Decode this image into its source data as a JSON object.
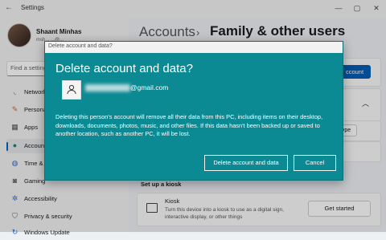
{
  "window": {
    "title": "Settings"
  },
  "profile": {
    "name": "Shaant Minhas",
    "email": "msh... ...@..."
  },
  "search": {
    "placeholder": "Find a setting"
  },
  "nav": [
    {
      "label": "Network & internet",
      "icon": "wifi-icon"
    },
    {
      "label": "Personalization",
      "icon": "brush-icon"
    },
    {
      "label": "Apps",
      "icon": "apps-icon"
    },
    {
      "label": "Accounts",
      "icon": "person-icon"
    },
    {
      "label": "Time & language",
      "icon": "globe-icon"
    },
    {
      "label": "Gaming",
      "icon": "controller-icon"
    },
    {
      "label": "Accessibility",
      "icon": "accessibility-icon"
    },
    {
      "label": "Privacy & security",
      "icon": "shield-icon"
    },
    {
      "label": "Windows Update",
      "icon": "update-icon"
    }
  ],
  "breadcrumb": {
    "parent": "Accounts",
    "separator": "›",
    "current": "Family & other users"
  },
  "main": {
    "add_account_label": "ccount",
    "type_label": "ype",
    "kiosk_heading": "Set up a kiosk",
    "kiosk_title": "Kiosk",
    "kiosk_desc": "Turn this device into a kiosk to use as a digital sign, interactive display, or other things",
    "get_started": "Get started"
  },
  "dialog": {
    "titlebar": "Delete account and data?",
    "heading": "Delete account and data?",
    "email_suffix": "@gmail.com",
    "body": "Deleting this person's account will remove all their data from this PC, including items on their desktop, downloads, documents, photos, music, and other files. If this data hasn't been backed up or saved to another location, such as another PC, it will be lost.",
    "primary_button": "Delete account and data",
    "cancel_button": "Cancel"
  }
}
